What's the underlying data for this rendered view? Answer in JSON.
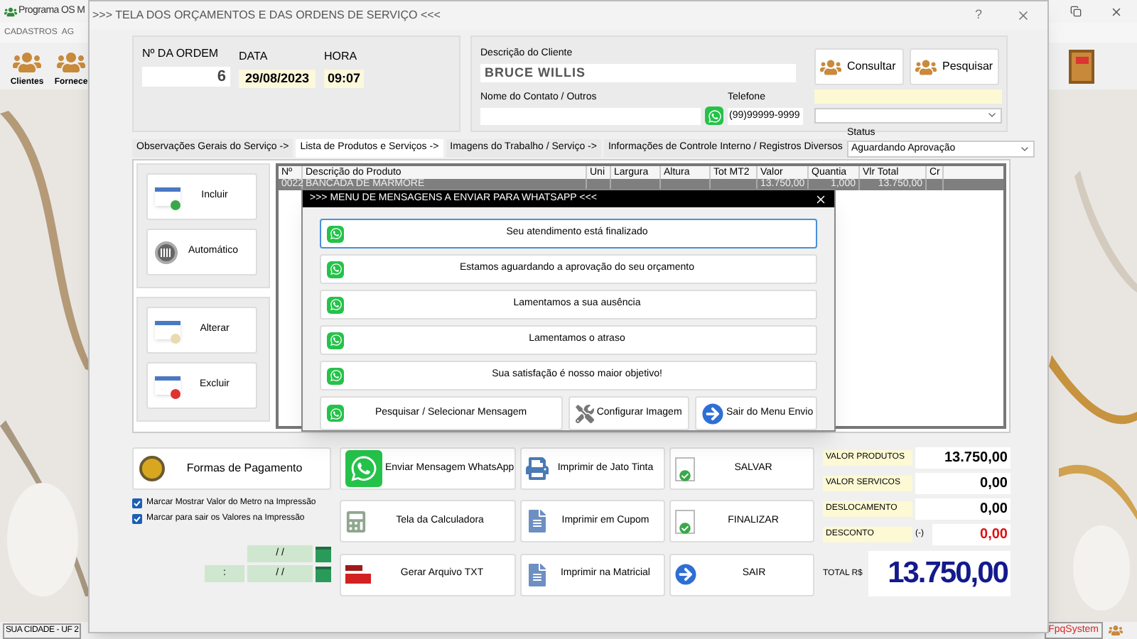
{
  "app": {
    "title": "Programa OS M",
    "menu": [
      "CADASTROS",
      "AG"
    ],
    "toolbar": [
      {
        "label": "Clientes"
      },
      {
        "label": "Fornece"
      }
    ],
    "status_bar": [
      "SUA CIDADE - UF 2",
      "FpqSystem"
    ]
  },
  "dialog": {
    "title": ">>> TELA DOS ORÇAMENTOS E DAS ORDENS DE SERVIÇO <<<",
    "help": "?",
    "order": {
      "number_label": "Nº DA ORDEM",
      "number": "6",
      "date_label": "DATA",
      "date": "29/08/2023",
      "time_label": "HORA",
      "time": "09:07"
    },
    "client": {
      "description_label": "Descrição do Cliente",
      "description": "BRUCE WILLIS",
      "contact_label": "Nome do Contato / Outros",
      "phone_label": "Telefone",
      "phone": "(99)99999-9999",
      "buttons": [
        "Consultar",
        "Pesquisar"
      ],
      "status_label": "Status",
      "status": "Aguardando Aprovação"
    },
    "tabs": [
      {
        "label": "Observações Gerais do Serviço ->",
        "selected": false
      },
      {
        "label": "Lista de Produtos e Serviços ->",
        "selected": true
      },
      {
        "label": "Imagens do Trabalho / Serviço ->",
        "selected": false
      },
      {
        "label": "Informações de Controle Interno / Registros Diversos",
        "selected": false
      }
    ],
    "side_buttons": [
      {
        "label": "Incluir",
        "kind": "add"
      },
      {
        "label": "Automático",
        "kind": "auto"
      },
      {
        "label": "Alterar",
        "kind": "edit"
      },
      {
        "label": "Excluir",
        "kind": "delete"
      }
    ],
    "table": {
      "columns": [
        "Nº",
        "Descrição do Produto",
        "Uni",
        "Largura",
        "Altura",
        "Tot MT2",
        "Valor",
        "Quantia",
        "Vlr Total",
        "Cr"
      ],
      "rows": [
        {
          "cells": [
            "0022",
            "BANCADA DE MARMORE",
            "",
            "",
            "",
            "",
            "13.750,00",
            "1,000",
            "13.750,00",
            ""
          ],
          "selected": true
        }
      ]
    },
    "payment_button": "Formas de Pagamento",
    "checkboxes": [
      {
        "label": "Marcar Mostrar Valor do Metro na Impressão",
        "checked": true
      },
      {
        "label": "Marcar para sair os Valores na Impressão",
        "checked": true
      }
    ],
    "date_fields": [
      "/ /",
      ":",
      "/ /"
    ],
    "actions": [
      {
        "label": "Enviar Mensagem WhatsApp",
        "kind": "whatsapp"
      },
      {
        "label": "Imprimir de Jato Tinta",
        "kind": "printer"
      },
      {
        "label": "SALVAR",
        "kind": "doc"
      },
      {
        "label": "Tela da Calculadora",
        "kind": "calculator"
      },
      {
        "label": "Imprimir em Cupom",
        "kind": "print-doc"
      },
      {
        "label": "FINALIZAR",
        "kind": "doc"
      },
      {
        "label": "Gerar Arquivo TXT",
        "kind": "txt"
      },
      {
        "label": "Imprimir na Matricial",
        "kind": "print-doc"
      },
      {
        "label": "SAIR",
        "kind": "exit"
      }
    ],
    "totals": [
      {
        "label": "VALOR PRODUTOS",
        "value": "13.750,00",
        "kind": "normal"
      },
      {
        "label": "VALOR SERVICOS",
        "value": "0,00",
        "kind": "normal"
      },
      {
        "label": "DESLOCAMENTO",
        "value": "0,00",
        "kind": "normal"
      },
      {
        "label": "DESCONTO",
        "prefix": "(-)",
        "value": "0,00",
        "kind": "discount"
      }
    ],
    "total": {
      "label": "TOTAL R$",
      "value": "13.750,00"
    }
  },
  "modal": {
    "title": ">>> MENU DE MENSAGENS A ENVIAR PARA WHATSAPP <<<",
    "messages": [
      {
        "label": "Seu atendimento está finalizado",
        "selected": true
      },
      {
        "label": "Estamos aguardando a aprovação do seu orçamento",
        "selected": false
      },
      {
        "label": "Lamentamos a sua ausência",
        "selected": false
      },
      {
        "label": "Lamentamos o atraso",
        "selected": false
      },
      {
        "label": "Sua satisfação é nosso maior objetivo!",
        "selected": false
      }
    ],
    "footer": [
      {
        "label": "Pesquisar / Selecionar Mensagem",
        "kind": "whatsapp"
      },
      {
        "label": "Configurar Imagem",
        "kind": "tools"
      },
      {
        "label": "Sair do Menu Envio",
        "kind": "exit"
      }
    ]
  }
}
